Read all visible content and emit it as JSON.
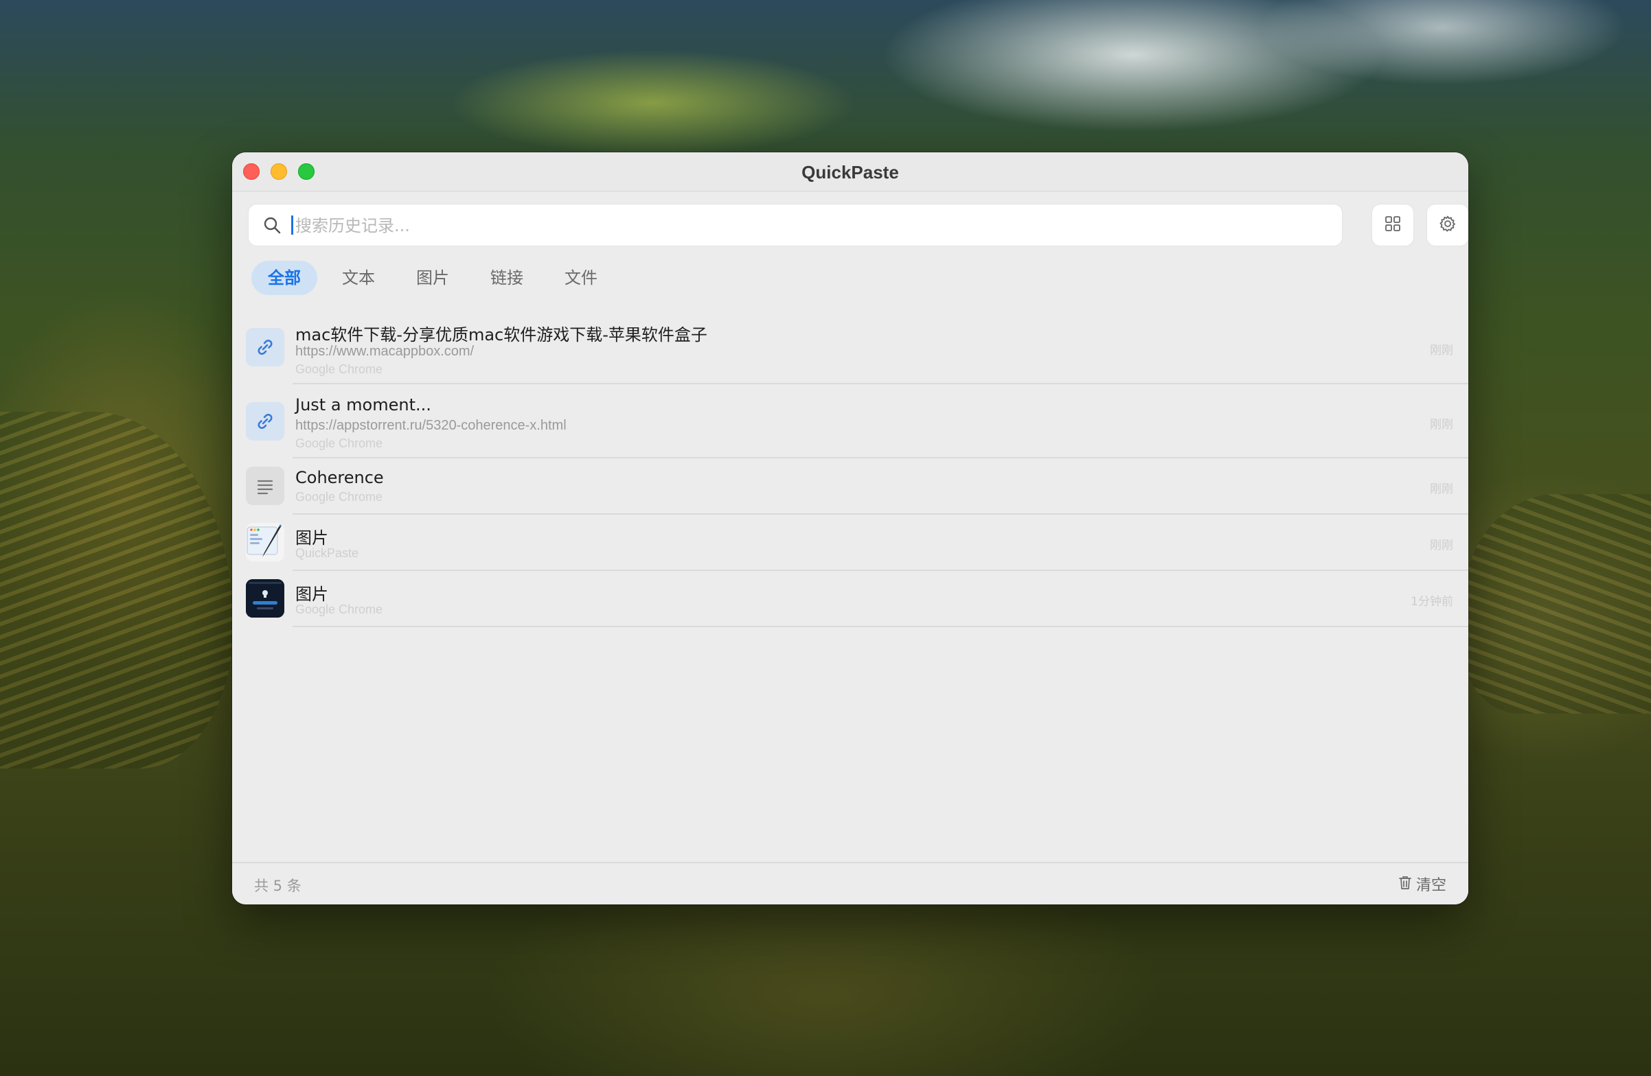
{
  "window": {
    "title": "QuickPaste"
  },
  "search": {
    "placeholder": "搜索历史记录...",
    "value": ""
  },
  "toolbar": {
    "grid_icon": "grid-icon",
    "settings_icon": "gear-icon"
  },
  "tabs": [
    {
      "label": "全部",
      "active": true
    },
    {
      "label": "文本",
      "active": false
    },
    {
      "label": "图片",
      "active": false
    },
    {
      "label": "链接",
      "active": false
    },
    {
      "label": "文件",
      "active": false
    }
  ],
  "items": [
    {
      "type": "link",
      "icon": "link-icon",
      "title": "mac软件下载-分享优质mac软件游戏下载-苹果软件盒子",
      "url": "https://www.macappbox.com/",
      "source": "Google Chrome",
      "time": "刚刚"
    },
    {
      "type": "link",
      "icon": "link-icon",
      "title": "Just a moment...",
      "url": "https://appstorrent.ru/5320-coherence-x.html",
      "source": "Google Chrome",
      "time": "刚刚"
    },
    {
      "type": "text",
      "icon": "text-lines-icon",
      "title": "Coherence",
      "source": "Google Chrome",
      "time": "刚刚"
    },
    {
      "type": "image",
      "icon": "image-thumbnail-icon",
      "title": "图片",
      "source": "QuickPaste",
      "time": "刚刚"
    },
    {
      "type": "image",
      "icon": "image-thumbnail-icon",
      "title": "图片",
      "source": "Google Chrome",
      "time": "1分钟前"
    }
  ],
  "footer": {
    "count_label": "共 5 条",
    "clear_label": "清空",
    "clear_icon": "trash-icon"
  },
  "colors": {
    "accent": "#1a73e8",
    "active_tab_bg": "#cfe1f5",
    "window_bg": "#ececec",
    "close": "#fe5f57",
    "minimize": "#febc2e",
    "maximize": "#28c840"
  }
}
